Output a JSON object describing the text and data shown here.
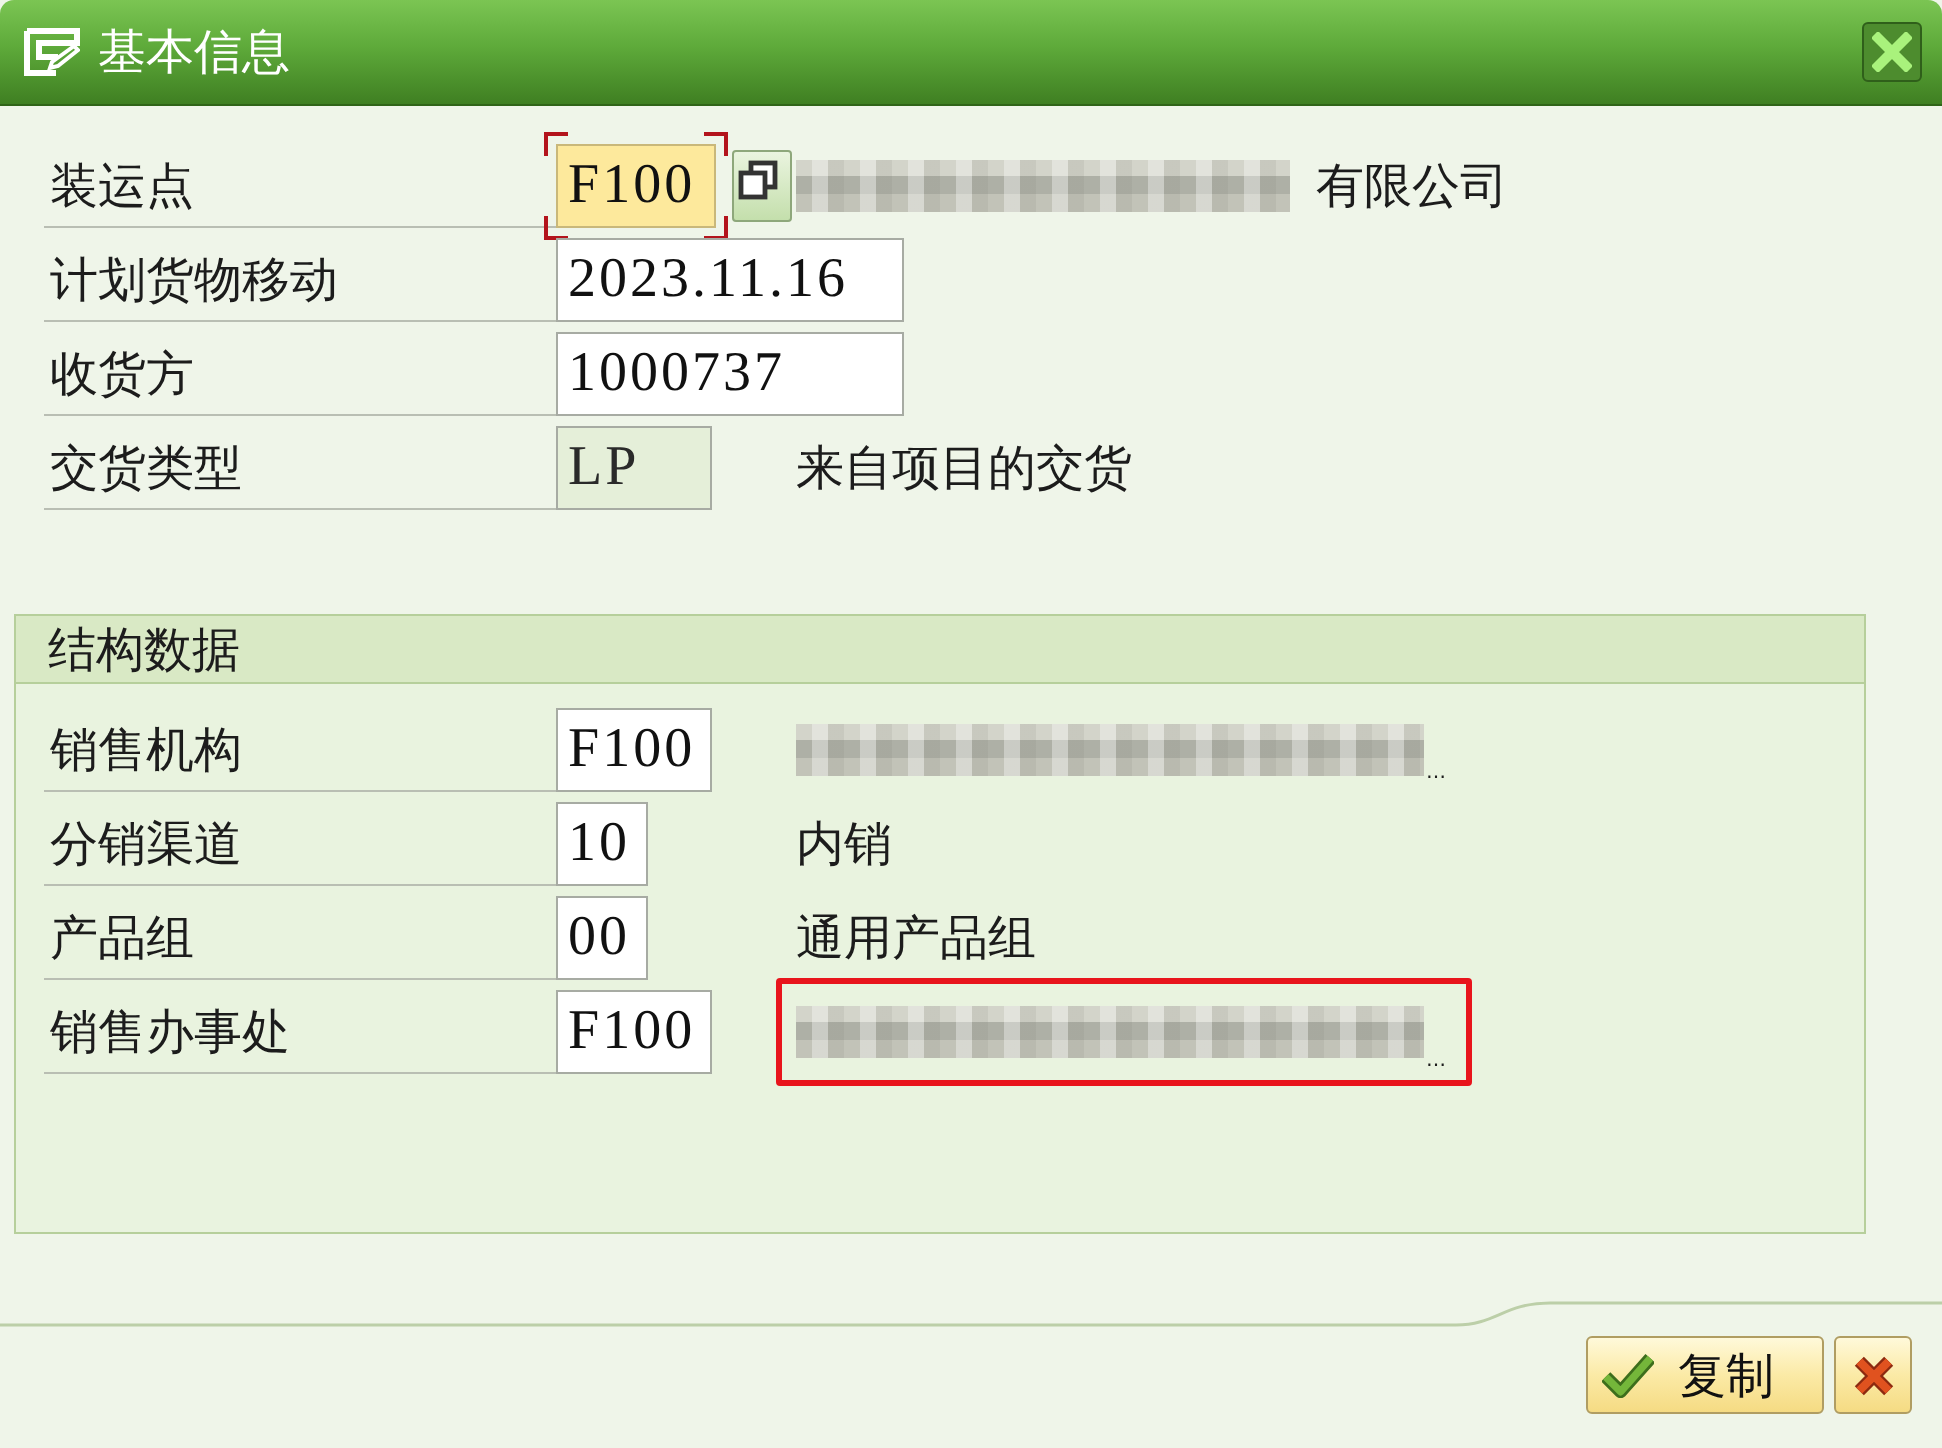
{
  "window": {
    "title": "基本信息"
  },
  "header_fields": [
    {
      "label": "装运点",
      "kind": "code",
      "value": "F100",
      "focused": true,
      "disabled": false,
      "action_button": true,
      "highlighted": false,
      "description": {
        "redacted": true,
        "text": "有限公司"
      }
    },
    {
      "label": "计划货物移动",
      "kind": "date",
      "value": "2023.11.16",
      "focused": false,
      "disabled": false,
      "action_button": false,
      "highlighted": false
    },
    {
      "label": "收货方",
      "kind": "partner",
      "value": "1000737",
      "focused": false,
      "disabled": false,
      "action_button": false,
      "highlighted": false
    },
    {
      "label": "交货类型",
      "kind": "code",
      "value": "LP",
      "focused": false,
      "disabled": true,
      "action_button": false,
      "highlighted": false,
      "description": {
        "redacted": false,
        "text": "来自项目的交货"
      }
    }
  ],
  "structure_group": {
    "title": "结构数据",
    "fields": [
      {
        "label": "销售机构",
        "kind": "code",
        "value": "F100",
        "focused": false,
        "disabled": false,
        "action_button": false,
        "highlighted": false,
        "description": {
          "redacted": true,
          "text": "…"
        }
      },
      {
        "label": "分销渠道",
        "kind": "short_code",
        "value": "10",
        "focused": false,
        "disabled": false,
        "action_button": false,
        "highlighted": false,
        "description": {
          "redacted": false,
          "text": "内销"
        }
      },
      {
        "label": "产品组",
        "kind": "short_code",
        "value": "00",
        "focused": false,
        "disabled": false,
        "action_button": false,
        "highlighted": false,
        "description": {
          "redacted": false,
          "text": "通用产品组"
        }
      },
      {
        "label": "销售办事处",
        "kind": "code",
        "value": "F100",
        "focused": false,
        "disabled": false,
        "action_button": false,
        "highlighted": true,
        "description": {
          "redacted": true,
          "text": "…"
        }
      }
    ]
  },
  "buttons": [
    {
      "kind": "confirm",
      "label": "复制"
    },
    {
      "kind": "cancel"
    }
  ]
}
